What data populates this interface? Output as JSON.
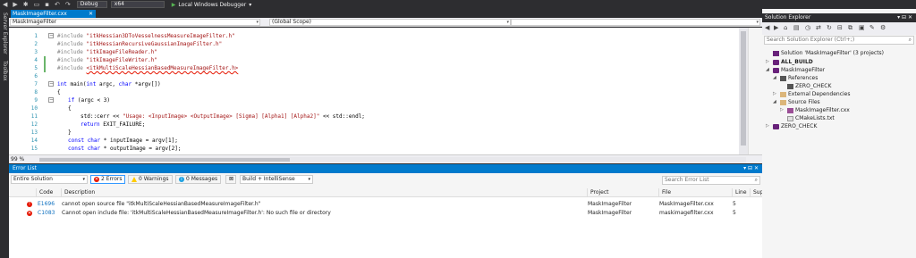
{
  "toolbar": {
    "configuration": "Debug",
    "platform": "x64",
    "run_label": "Local Windows Debugger"
  },
  "left_strip": {
    "server_explorer": "Server Explorer",
    "toolbox": "Toolbox"
  },
  "editor": {
    "tab_title": "MaskImageFilter.cxx",
    "nav_project": "MaskImageFilter",
    "nav_scope": "(Global Scope)",
    "zoom": "99 %",
    "line_numbers": [
      "1",
      "2",
      "3",
      "4",
      "5",
      "6",
      "7",
      "8",
      "9",
      "10",
      "11",
      "12",
      "13",
      "14",
      "15"
    ],
    "lines": {
      "l1_a": "#include ",
      "l1_b": "\"itkHessian3DToVesselnessMeasureImageFilter.h\"",
      "l2_a": "#include ",
      "l2_b": "\"itkHessianRecursiveGaussianImageFilter.h\"",
      "l3_a": "#include ",
      "l3_b": "\"itkImageFileReader.h\"",
      "l4_a": "#include ",
      "l4_b": "\"itkImageFileWriter.h\"",
      "l5_a": "#include ",
      "l5_b": "<itkMultiScaleHessianBasedMeasureImageFilter.h>",
      "l7_a": "int",
      "l7_b": " main(",
      "l7_c": "int",
      "l7_d": " argc, ",
      "l7_e": "char",
      "l7_f": " *argv[])",
      "l8": "{",
      "l9_a": "if",
      "l9_b": " (argc < 3)",
      "l10": "{",
      "l11_a": "std::cerr << ",
      "l11_b": "\"Usage: <InputImage> <OutputImage> [Sigma] [Alpha1] [Alpha2]\"",
      "l11_c": " << std::endl;",
      "l12_a": "return",
      "l12_b": " EXIT_FAILURE;",
      "l13": "}",
      "l14_a": "const",
      "l14_b": " ",
      "l14_c": "char",
      "l14_d": " * inputImage = argv[1];",
      "l15_a": "const",
      "l15_b": " ",
      "l15_c": "char",
      "l15_d": " * outputImage = argv[2];"
    }
  },
  "error_list": {
    "title": "Error List",
    "scope": "Entire Solution",
    "errors_filter": "2 Errors",
    "warnings_filter": "0 Warnings",
    "messages_filter": "0 Messages",
    "build_filter": "Build + IntelliSense",
    "search_placeholder": "Search Error List",
    "columns": {
      "code": "Code",
      "description": "Description",
      "project": "Project",
      "file": "File",
      "line": "Line",
      "suppression": "Sup"
    },
    "rows": [
      {
        "code": "E1696",
        "description": "cannot open source file \"itkMultiScaleHessianBasedMeasureImageFilter.h\"",
        "project": "MaskImageFilter",
        "file": "MaskImageFilter.cxx",
        "line": "5"
      },
      {
        "code": "C1083",
        "description": "Cannot open include file: 'itkMultiScaleHessianBasedMeasureImageFilter.h': No such file or directory",
        "project": "MaskImageFilter",
        "file": "maskimagefilter.cxx",
        "line": "5"
      }
    ]
  },
  "solution_explorer": {
    "title": "Solution Explorer",
    "search_placeholder": "Search Solution Explorer (Ctrl+;)",
    "items": [
      {
        "label": "Solution 'MaskImageFilter' (3 projects)"
      },
      {
        "label": "ALL_BUILD"
      },
      {
        "label": "MaskImageFilter"
      },
      {
        "label": "References"
      },
      {
        "label": "ZERO_CHECK"
      },
      {
        "label": "External Dependencies"
      },
      {
        "label": "Source Files"
      },
      {
        "label": "MaskImageFilter.cxx"
      },
      {
        "label": "CMakeLists.txt"
      },
      {
        "label": "ZERO_CHECK"
      }
    ]
  },
  "colors": {
    "accent": "#007acc",
    "error": "#e51400",
    "chrome_dark": "#2d2d30"
  }
}
